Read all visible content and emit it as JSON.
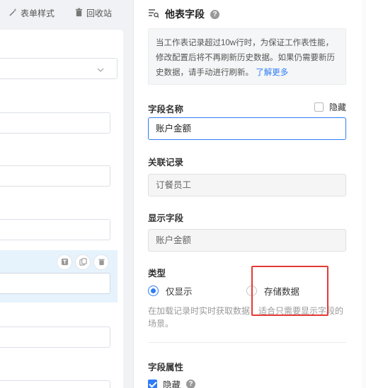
{
  "toolbar": {
    "form_style_label": "表单样式",
    "recycle_bin_label": "回收站"
  },
  "panel": {
    "title": "他表字段",
    "help_glyph": "?",
    "notice_text": "当工作表记录超过10w行时，为保证工作表性能，修改配置后将不再刷新历史数据。如果仍需要新历史数据，请手动进行刷新。",
    "notice_link": "了解更多",
    "field_name_label": "字段名称",
    "hide_label": "隐藏",
    "field_name_value": "账户金额",
    "related_record_label": "关联记录",
    "related_record_value": "订餐员工",
    "display_field_label": "显示字段",
    "display_field_value": "账户金额",
    "type_label": "类型",
    "type_options": [
      "仅显示",
      "存储数据"
    ],
    "type_selected": "仅显示",
    "type_description": "在加载记录时实时获取数据，适合只需要显示字段的场景。",
    "field_attrs_label": "字段属性",
    "attr_hidden_label": "隐藏",
    "attr_hidden_checked": true
  },
  "colors": {
    "accent": "#2f7cf6",
    "highlight": "#e53935",
    "selected_block": "#e6f3fd"
  },
  "icons": [
    "magic-wand-icon",
    "trash-icon",
    "field-list-icon",
    "help-icon",
    "chevron-down-icon",
    "text-type-icon",
    "copy-icon"
  ]
}
